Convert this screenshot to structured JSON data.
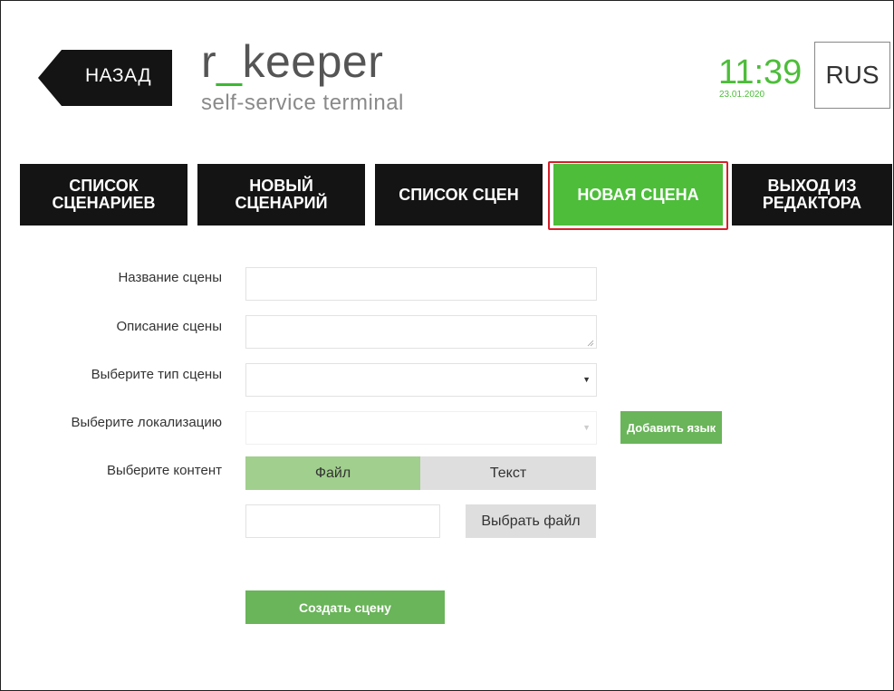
{
  "header": {
    "back_label": "НАЗАД",
    "logo_prefix": "r",
    "logo_underscore": "_",
    "logo_suffix": "keeper",
    "logo_subtitle": "self-service terminal",
    "time": "11:39",
    "date": "23.01.2020",
    "language": "RUS"
  },
  "tabs": [
    {
      "line1": "СПИСОК",
      "line2": "СЦЕНАРИЕВ",
      "active": false
    },
    {
      "line1": "НОВЫЙ",
      "line2": "СЦЕНАРИЙ",
      "active": false
    },
    {
      "line1": "СПИСОК СЦЕН",
      "line2": "",
      "active": true
    },
    {
      "line1": "НОВАЯ СЦЕНА",
      "line2": "",
      "active": true
    },
    {
      "line1": "ВЫХОД ИЗ",
      "line2": "РЕДАКТОРА",
      "active": false
    }
  ],
  "form": {
    "scene_name_label": "Название сцены",
    "scene_name_value": "",
    "scene_desc_label": "Описание сцены",
    "scene_desc_value": "",
    "scene_type_label": "Выберите тип сцены",
    "scene_type_value": "",
    "locale_label": "Выберите локализацию",
    "locale_value": "",
    "add_language_label": "Добавить язык",
    "content_label": "Выберите контент",
    "content_options": [
      "Файл",
      "Текст"
    ],
    "content_selected": "Файл",
    "file_value": "",
    "choose_file_label": "Выбрать файл",
    "create_label": "Создать сцену"
  },
  "colors": {
    "brand_green": "#4dbd3a",
    "button_green": "#6ab45a",
    "tab_dark": "#141414",
    "highlight_red": "#d61f2a"
  }
}
